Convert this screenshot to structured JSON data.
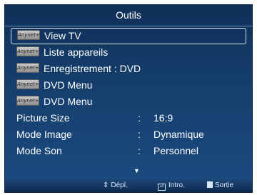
{
  "title": "Outils",
  "icon_label": "Anynet+",
  "menu": [
    {
      "label": "View TV",
      "icon": "anynet-icon"
    },
    {
      "label": "Liste appareils",
      "icon": "anynet-icon"
    },
    {
      "label": "Enregistrement : DVD",
      "icon": "anynet-icon"
    },
    {
      "label": "DVD Menu",
      "icon": "anynet-icon"
    },
    {
      "label": "DVD Menu",
      "icon": "anynet-icon"
    }
  ],
  "settings": [
    {
      "label": "Picture Size",
      "colon": ":",
      "value": "16:9"
    },
    {
      "label": "Mode Image",
      "colon": ":",
      "value": "Dynamique"
    },
    {
      "label": "Mode Son",
      "colon": ":",
      "value": "Personnel"
    }
  ],
  "scroll_arrow": "▼",
  "footer": {
    "move_icon": "⇕",
    "move_label": "Dépl.",
    "enter_icon": "⏎",
    "enter_label": "Intro.",
    "exit_icon": "exit-icon",
    "exit_label": "Sortie"
  }
}
